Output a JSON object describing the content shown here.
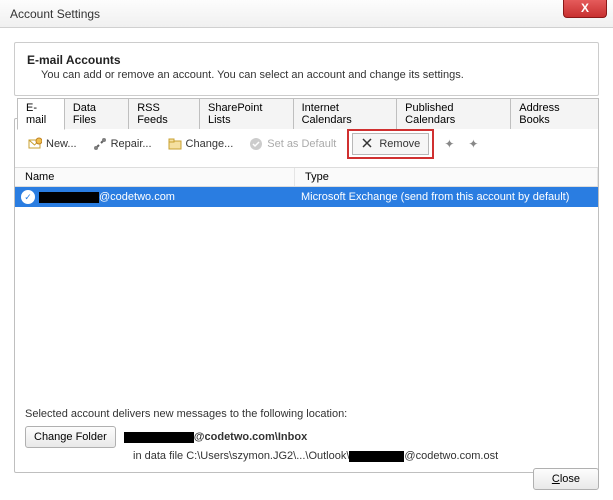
{
  "window": {
    "title": "Account Settings",
    "close_x": "X"
  },
  "header": {
    "title": "E-mail Accounts",
    "subtitle": "You can add or remove an account. You can select an account and change its settings."
  },
  "tabs": [
    {
      "label": "E-mail"
    },
    {
      "label": "Data Files"
    },
    {
      "label": "RSS Feeds"
    },
    {
      "label": "SharePoint Lists"
    },
    {
      "label": "Internet Calendars"
    },
    {
      "label": "Published Calendars"
    },
    {
      "label": "Address Books"
    }
  ],
  "toolbar": {
    "new": "New...",
    "repair": "Repair...",
    "change": "Change...",
    "set_default": "Set as Default",
    "remove": "Remove"
  },
  "columns": {
    "name": "Name",
    "type": "Type"
  },
  "accounts": [
    {
      "name_suffix": "@codetwo.com",
      "type": "Microsoft Exchange (send from this account by default)"
    }
  ],
  "delivery": {
    "intro": "Selected account delivers new messages to the following location:",
    "change_folder": "Change Folder",
    "folder_suffix": "@codetwo.com\\Inbox",
    "path_prefix": "in data file C:\\Users\\szymon.JG2\\...\\Outlook\\",
    "path_suffix": "@codetwo.com.ost"
  },
  "footer": {
    "close": "Close"
  }
}
